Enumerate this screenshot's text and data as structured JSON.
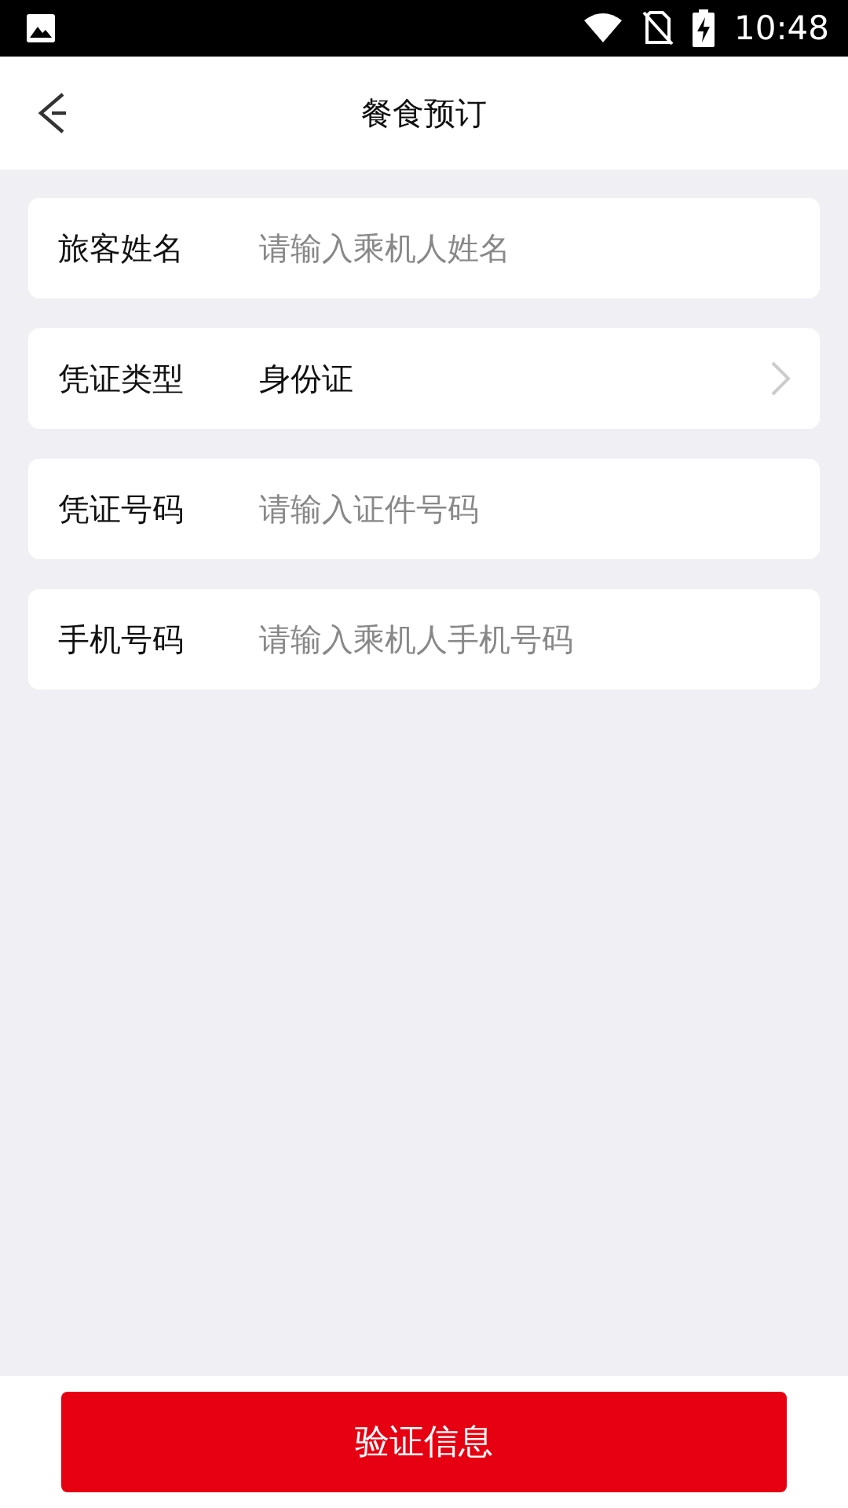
{
  "status_bar": {
    "time": "10:48"
  },
  "header": {
    "title": "餐食预订"
  },
  "form": {
    "rows": [
      {
        "kind": "input",
        "label": "旅客姓名",
        "placeholder": "请输入乘机人姓名"
      },
      {
        "kind": "select",
        "label": "凭证类型",
        "value": "身份证"
      },
      {
        "kind": "input",
        "label": "凭证号码",
        "placeholder": "请输入证件号码"
      },
      {
        "kind": "input",
        "label": "手机号码",
        "placeholder": "请输入乘机人手机号码"
      }
    ]
  },
  "submit_button": {
    "label": "验证信息"
  }
}
